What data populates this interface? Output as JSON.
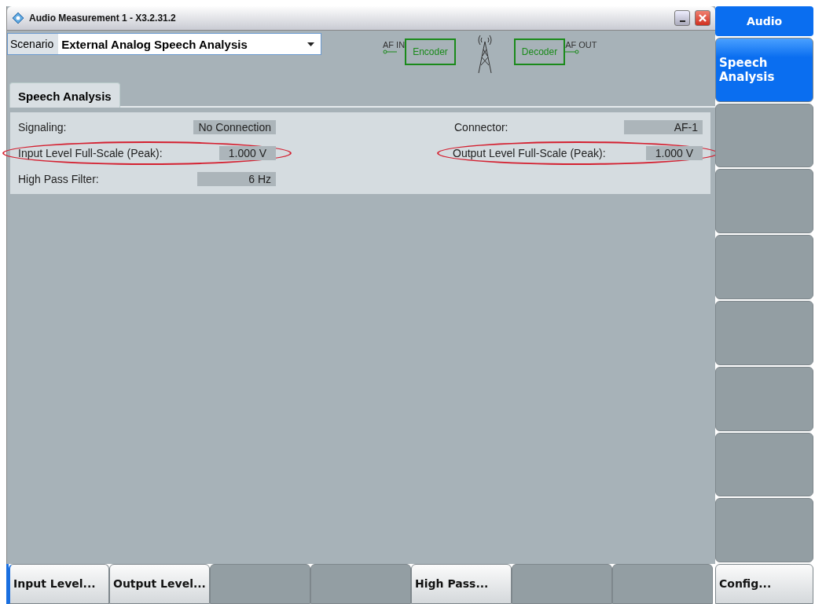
{
  "window": {
    "title": "Audio Measurement 1 - X3.2.31.2"
  },
  "scenario": {
    "label": "Scenario",
    "value": "External Analog Speech Analysis"
  },
  "diagram": {
    "input_label": "AF IN",
    "encoder": "Encoder",
    "decoder": "Decoder",
    "output_label": "AF OUT"
  },
  "tabs": [
    {
      "label": "Speech Analysis",
      "selected": true
    }
  ],
  "parameters": [
    {
      "label": "Signaling:",
      "value": "No Connection",
      "highlighted": false
    },
    {
      "label": "Connector:",
      "value": "AF-1",
      "highlighted": false
    },
    {
      "label": "Input Level Full-Scale (Peak):",
      "value": "1.000 V",
      "highlighted": true
    },
    {
      "label": "Output Level Full-Scale (Peak):",
      "value": "1.000 V",
      "highlighted": true
    },
    {
      "label": "High Pass Filter:",
      "value": "6 Hz",
      "highlighted": false
    }
  ],
  "sidebar": {
    "title": "Audio",
    "items": [
      {
        "label": "Speech Analysis",
        "selected": true,
        "enabled": true
      },
      {
        "selected": false,
        "enabled": false
      },
      {
        "selected": false,
        "enabled": false
      },
      {
        "selected": false,
        "enabled": false
      },
      {
        "selected": false,
        "enabled": false
      },
      {
        "selected": false,
        "enabled": false
      },
      {
        "selected": false,
        "enabled": false
      },
      {
        "selected": false,
        "enabled": false
      }
    ]
  },
  "softkeys": [
    {
      "label": "Input Level...",
      "enabled": true,
      "selected": true
    },
    {
      "label": "Output Level...",
      "enabled": true,
      "selected": false
    },
    {
      "enabled": false,
      "selected": false
    },
    {
      "enabled": false,
      "selected": false
    },
    {
      "label": "High Pass...",
      "enabled": true,
      "selected": false
    },
    {
      "enabled": false,
      "selected": false
    },
    {
      "enabled": false,
      "selected": false
    }
  ],
  "config_key": {
    "label": "Config..."
  }
}
